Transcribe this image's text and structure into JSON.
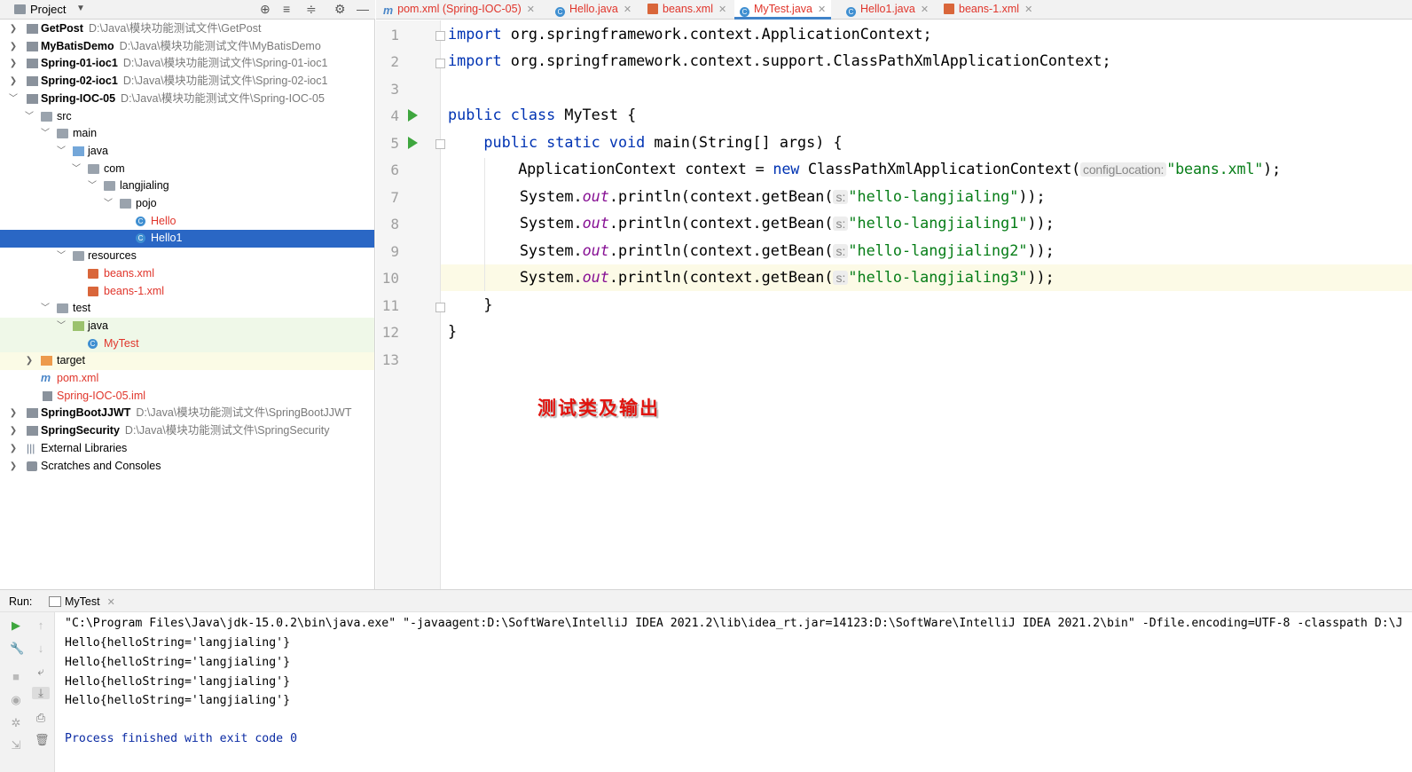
{
  "project_panel": {
    "title": "Project",
    "items": [
      {
        "name": "GetPost",
        "path": "D:\\Java\\模块功能测试文件\\GetPost"
      },
      {
        "name": "MyBatisDemo",
        "path": "D:\\Java\\模块功能测试文件\\MyBatisDemo"
      },
      {
        "name": "Spring-01-ioc1",
        "path": "D:\\Java\\模块功能测试文件\\Spring-01-ioc1"
      },
      {
        "name": "Spring-02-ioc1",
        "path": "D:\\Java\\模块功能测试文件\\Spring-02-ioc1"
      },
      {
        "name": "Spring-IOC-05",
        "path": "D:\\Java\\模块功能测试文件\\Spring-IOC-05"
      },
      {
        "name": "src"
      },
      {
        "name": "main"
      },
      {
        "name": "java"
      },
      {
        "name": "com"
      },
      {
        "name": "langjialing"
      },
      {
        "name": "pojo"
      },
      {
        "name": "Hello"
      },
      {
        "name": "Hello1"
      },
      {
        "name": "resources"
      },
      {
        "name": "beans.xml"
      },
      {
        "name": "beans-1.xml"
      },
      {
        "name": "test"
      },
      {
        "name": "java"
      },
      {
        "name": "MyTest"
      },
      {
        "name": "target"
      },
      {
        "name": "pom.xml"
      },
      {
        "name": "Spring-IOC-05.iml"
      },
      {
        "name": "SpringBootJJWT",
        "path": "D:\\Java\\模块功能测试文件\\SpringBootJJWT"
      },
      {
        "name": "SpringSecurity",
        "path": "D:\\Java\\模块功能测试文件\\SpringSecurity"
      },
      {
        "name": "External Libraries"
      },
      {
        "name": "Scratches and Consoles"
      }
    ]
  },
  "tabs": [
    {
      "label": "pom.xml (Spring-IOC-05)"
    },
    {
      "label": "Hello.java"
    },
    {
      "label": "beans.xml"
    },
    {
      "label": "MyTest.java"
    },
    {
      "label": "Hello1.java"
    },
    {
      "label": "beans-1.xml"
    }
  ],
  "editor": {
    "line_numbers": [
      "1",
      "2",
      "3",
      "4",
      "5",
      "6",
      "7",
      "8",
      "9",
      "10",
      "11",
      "12",
      "13"
    ],
    "current_line": "10",
    "code": {
      "l1_kw": "import",
      "l1_rest": " org.springframework.context.ApplicationContext;",
      "l2_kw": "import",
      "l2_rest": " org.springframework.context.support.ClassPathXmlApplicationContext;",
      "l4_kw": "public class",
      "l4_rest": " MyTest {",
      "l5_indent": "    ",
      "l5_kw": "public static void",
      "l5_rest": " main(String[] args) {",
      "l6_a": "        ApplicationContext context = ",
      "l6_kw": "new",
      "l6_b": " ClassPathXmlApplicationContext(",
      "l6_hint": "configLocation:",
      "l6_str": "\"beans.xml\"",
      "l6_end": ");",
      "print_a": "        System.",
      "print_out": "out",
      "print_b": ".println(context.getBean(",
      "print_hint": "s:",
      "l7_str": "\"hello-langjialing\"",
      "l8_str": "\"hello-langjialing1\"",
      "l9_str": "\"hello-langjialing2\"",
      "l10_str": "\"hello-langjialing3\"",
      "print_end": "));",
      "l11": "    }",
      "l12": "}"
    }
  },
  "annotation": "测试类及输出",
  "run_panel": {
    "label": "Run:",
    "tab": "MyTest",
    "console": [
      "\"C:\\Program Files\\Java\\jdk-15.0.2\\bin\\java.exe\" \"-javaagent:D:\\SoftWare\\IntelliJ IDEA 2021.2\\lib\\idea_rt.jar=14123:D:\\SoftWare\\IntelliJ IDEA 2021.2\\bin\" -Dfile.encoding=UTF-8 -classpath D:\\J",
      "Hello{helloString='langjialing'}",
      "Hello{helloString='langjialing'}",
      "Hello{helloString='langjialing'}",
      "Hello{helloString='langjialing'}",
      "Process finished with exit code 0"
    ]
  },
  "colors": {
    "selection": "#2a67c5",
    "keyword": "#0033b3",
    "string": "#067d17",
    "error_red": "#e0352b",
    "run_green": "#3ea63e"
  }
}
